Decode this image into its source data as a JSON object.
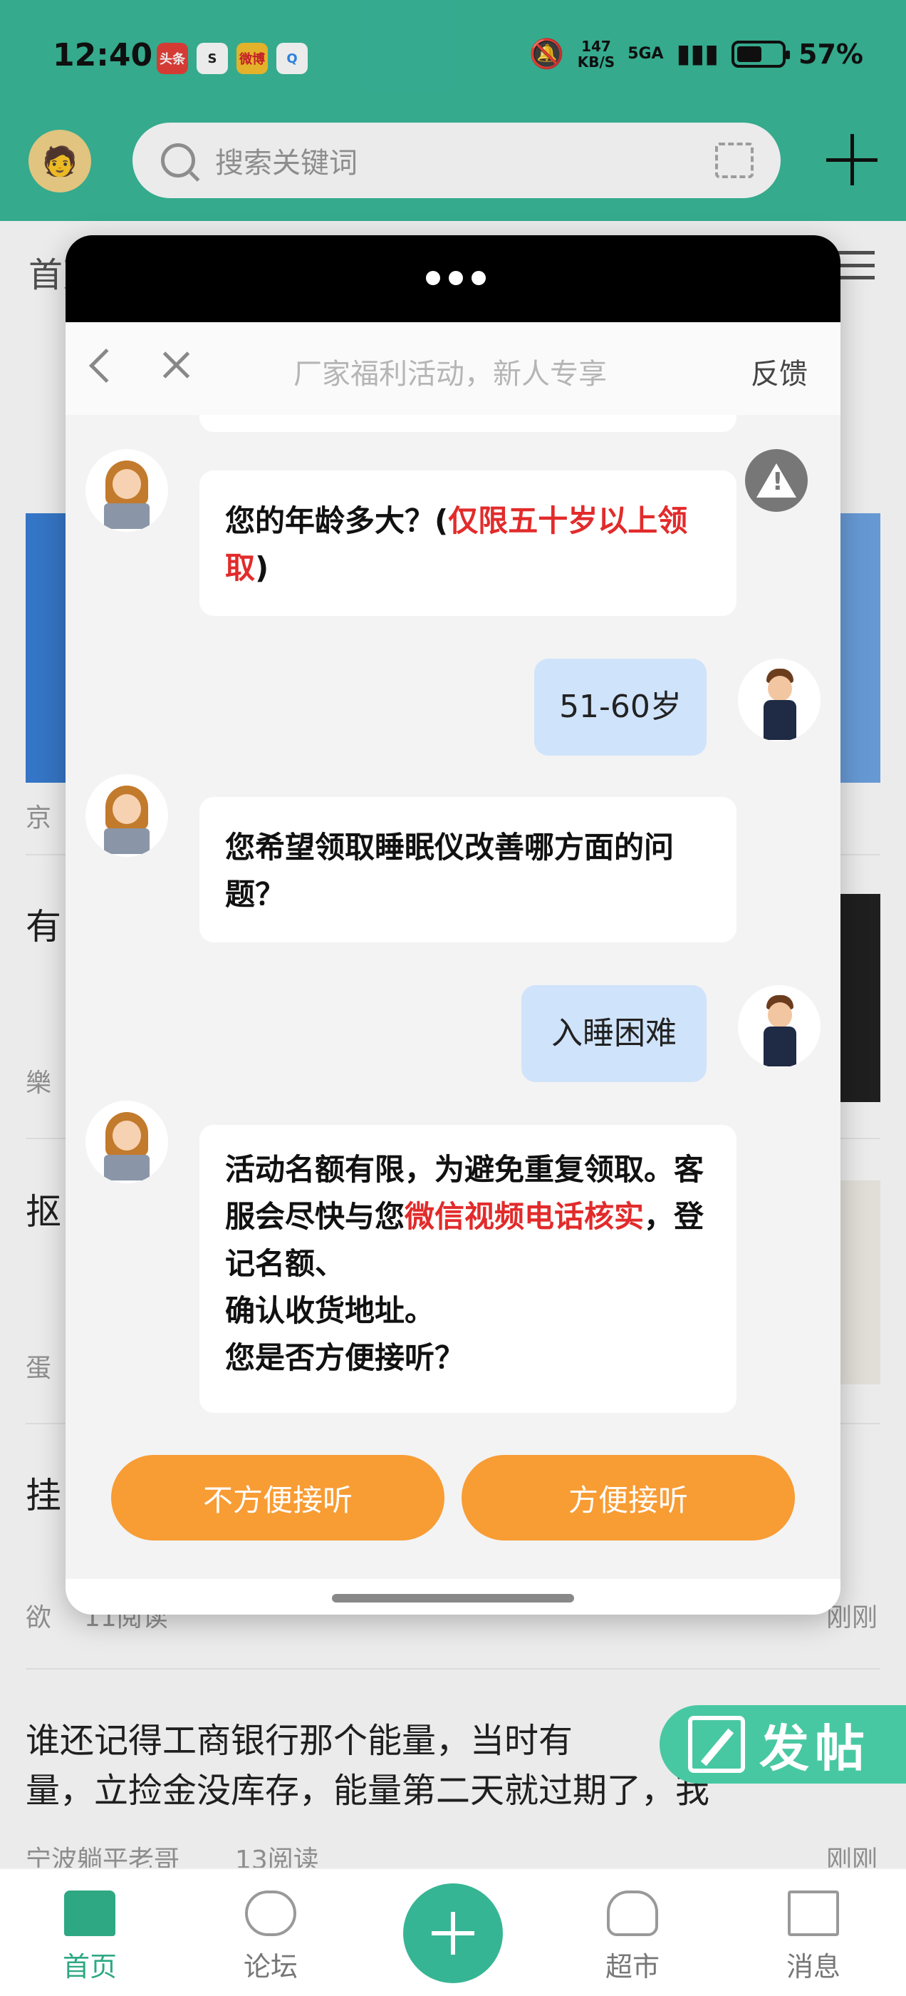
{
  "status_bar": {
    "time": "12:40",
    "app_icons": [
      "头条",
      "S",
      "微博",
      "Q"
    ],
    "net_speed_value": "147",
    "net_speed_unit": "KB/S",
    "signal": "5GA",
    "battery_percent": "57%",
    "battery_level": 0.57
  },
  "header": {
    "search_placeholder": "搜索关键词",
    "avatar_icon": "cartoon-avatar-icon"
  },
  "feed": {
    "tab_first": "首页",
    "item_titles": [
      "有",
      "抠",
      "挂"
    ],
    "metas": [
      "京",
      "樂",
      "蛋",
      "欲"
    ],
    "meta_reads": "11阅读",
    "meta_time": "刚刚",
    "last_title_line1": "谁还记得工商银行那个能量，当时有",
    "last_title_line2": "量，立捡金没库存，能量第二天就过期了，我",
    "last_author": "宁波躺平老哥",
    "last_reads": "13阅读",
    "last_time": "刚刚"
  },
  "post_button": {
    "label": "发帖"
  },
  "bottom_nav": {
    "items": [
      {
        "label": "首页",
        "icon": "home-icon"
      },
      {
        "label": "论坛",
        "icon": "chat-bubble-icon"
      },
      {
        "label": "超市",
        "icon": "money-bag-icon"
      },
      {
        "label": "消息",
        "icon": "mail-icon"
      }
    ],
    "active_index": 0
  },
  "modal": {
    "title": "厂家福利活动，新人专享",
    "feedback": "反馈",
    "messages": [
      {
        "from": "agent",
        "parts": [
          "您的年龄多大？(",
          "仅限五十岁以上领取",
          ")"
        ]
      },
      {
        "from": "user",
        "text": "51-60岁"
      },
      {
        "from": "agent",
        "parts": [
          "您希望领取睡眠仪改善哪方面的问题？"
        ]
      },
      {
        "from": "user",
        "text": "入睡困难"
      },
      {
        "from": "agent",
        "parts": [
          "活动名额有限，为避免重复领取。客服会尽快与您",
          "微信视频电话核实",
          "，登记名额、",
          "确认收货地址。",
          "您是否方便接听？"
        ]
      }
    ],
    "buttons": {
      "inconvenient": "不方便接听",
      "convenient": "方便接听"
    },
    "accent_color": "#f89c34",
    "highlight_color": "#e22b2b"
  }
}
